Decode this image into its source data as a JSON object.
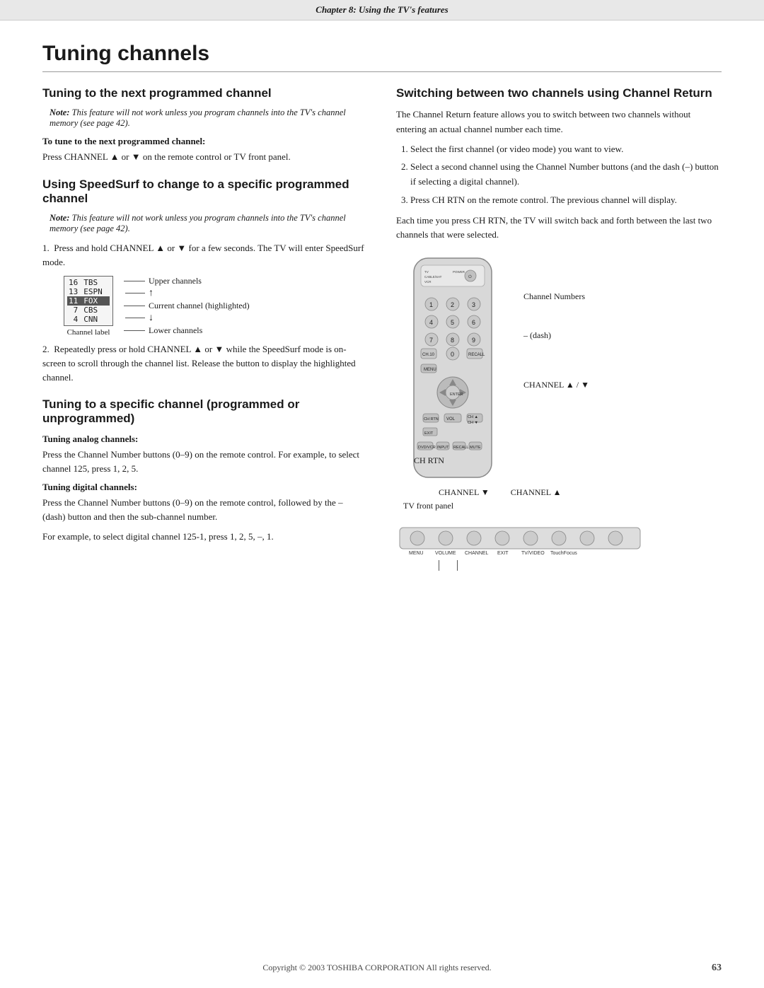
{
  "header": {
    "text": "Chapter 8: Using the TV's features"
  },
  "page_title": "Tuning channels",
  "left_col": {
    "section1": {
      "title": "Tuning to the next programmed channel",
      "note": {
        "bold": "Note:",
        "text": " This feature will not work unless you program channels into the TV's channel memory (see page 42)."
      },
      "subheading": "To tune to the next programmed channel:",
      "body": "Press CHANNEL ▲ or ▼ on the remote control or TV front panel."
    },
    "section2": {
      "title": "Using SpeedSurf to change to a specific programmed channel",
      "note": {
        "bold": "Note:",
        "text": " This feature will not work unless you program channels into the TV's channel memory (see page 42)."
      },
      "step1": "Press and hold CHANNEL ▲ or ▼ for a few seconds. The TV will enter SpeedSurf mode.",
      "diagram": {
        "channels": [
          {
            "num": "16",
            "name": "TBS"
          },
          {
            "num": "13",
            "name": "ESPN"
          },
          {
            "num": "11",
            "name": "FOX"
          },
          {
            "num": "7",
            "name": "CBS"
          },
          {
            "num": "4",
            "name": "CNN"
          }
        ],
        "highlighted_index": 2,
        "labels": {
          "upper": "Upper channels",
          "current": "Current channel (highlighted)",
          "lower": "Lower channels",
          "channel_label": "Channel label"
        }
      },
      "step2": "Repeatedly press or hold CHANNEL ▲ or ▼ while the SpeedSurf mode is on-screen to scroll through the channel list. Release the button to display the highlighted channel."
    },
    "section3": {
      "title": "Tuning to a specific channel (programmed or unprogrammed)",
      "analog_heading": "Tuning analog channels:",
      "analog_text": "Press the Channel Number buttons (0–9) on the remote control. For example, to select channel 125, press 1, 2, 5.",
      "digital_heading": "Tuning digital channels:",
      "digital_text": "Press the Channel Number buttons (0–9) on the remote control, followed by the – (dash) button and then the sub-channel number.",
      "digital_example": "For example, to select digital channel 125-1, press 1, 2, 5, –, 1."
    }
  },
  "right_col": {
    "section1": {
      "title": "Switching between two channels using Channel Return",
      "intro": "The Channel Return feature allows you to switch between two channels without entering an actual channel number each time.",
      "steps": [
        "Select the first channel (or video mode) you want to view.",
        "Select a second channel using the Channel Number buttons (and the dash (–) button if selecting a digital channel).",
        "Press CH RTN on the remote control. The previous channel will display."
      ],
      "closing": "Each time you press CH RTN, the TV will switch back and forth between the last two channels that were selected."
    },
    "remote_labels": {
      "channel_numbers": "Channel Numbers",
      "dash": "– (dash)",
      "channel_updown": "CHANNEL ▲ / ▼",
      "ch_rtn": "CH RTN"
    },
    "tv_panel_labels": {
      "channel_down": "CHANNEL ▼",
      "channel_up": "CHANNEL ▲",
      "tv_front_panel": "TV front panel",
      "buttons": [
        "MENU",
        "VOLUME",
        "CHANNEL",
        "EXIT",
        "TV/VIDEO",
        "TouchFocus"
      ]
    }
  },
  "footer": {
    "copyright": "Copyright © 2003 TOSHIBA CORPORATION  All rights reserved.",
    "page_number": "63"
  }
}
